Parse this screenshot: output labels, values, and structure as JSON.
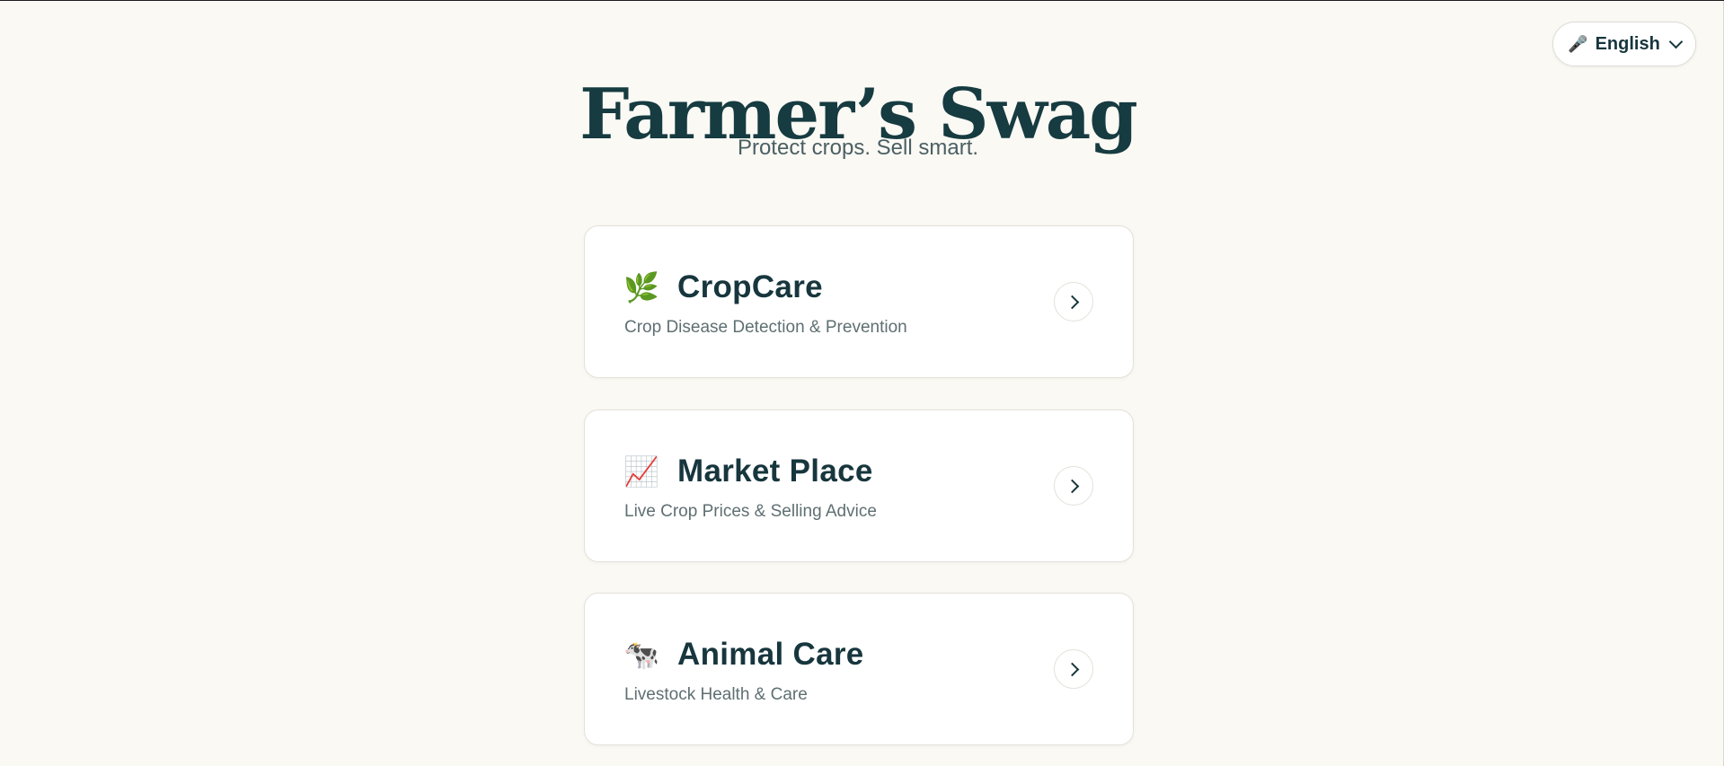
{
  "header": {
    "title": "Farmer’s Swag",
    "subtitle": "Protect crops. Sell smart."
  },
  "language": {
    "icon": "microphone-icon",
    "glyph": "🎤",
    "label": "English"
  },
  "cards": [
    {
      "icon": "herb-icon",
      "glyph": "🌿",
      "title": "CropCare",
      "description": "Crop Disease Detection & Prevention"
    },
    {
      "icon": "chart-increasing-icon",
      "glyph": "📈",
      "title": "Market Place",
      "description": "Live Crop Prices & Selling Advice"
    },
    {
      "icon": "cow-icon",
      "glyph": "🐄",
      "title": "Animal Care",
      "description": "Livestock Health & Care"
    }
  ],
  "colors": {
    "background": "#faf9f4",
    "primary_text": "#17363d",
    "muted_text": "#5f6f72",
    "card_background": "#ffffff"
  }
}
